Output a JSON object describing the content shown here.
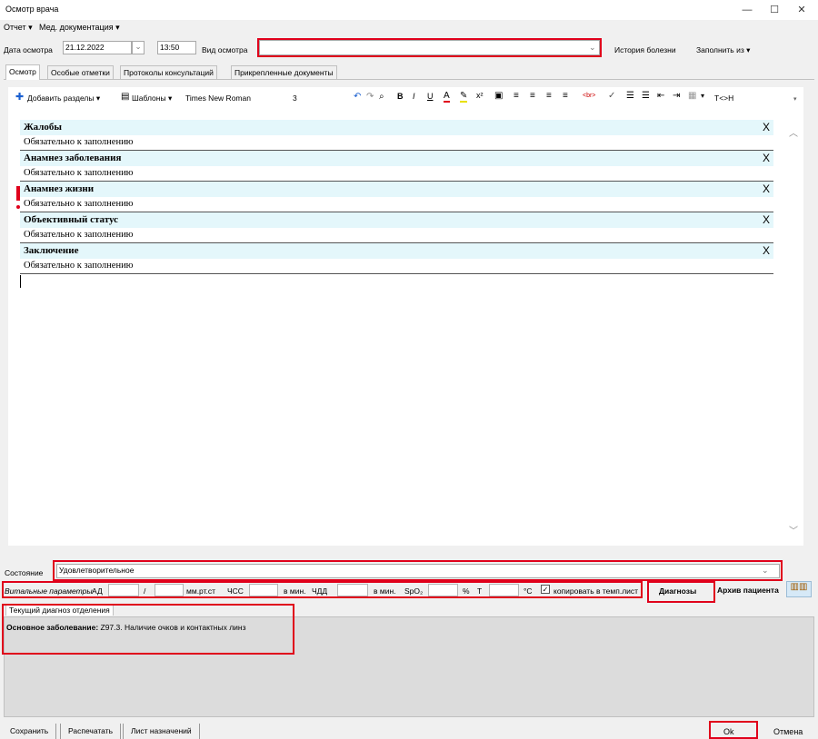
{
  "window": {
    "title": "Осмотр врача"
  },
  "menu": {
    "report": "Отчет ▾",
    "meddocs": "Мед. документация ▾"
  },
  "header": {
    "date_label": "Дата осмотра",
    "date_value": "21.12.2022",
    "time_value": "13:50",
    "type_label": "Вид осмотра",
    "type_value": "",
    "history_btn": "История болезни",
    "fill_from_btn": "Заполнить из ▾"
  },
  "tabs": [
    "Осмотр",
    "Особые отметки",
    "Протоколы консультаций",
    "Прикрепленные документы"
  ],
  "toolbar": {
    "add_sections": "Добавить разделы ▾",
    "templates": "Шаблоны ▾",
    "font": "Times New Roman",
    "font_size": "3",
    "html_tag": "T<>H"
  },
  "sections": [
    {
      "title": "Жалобы",
      "body": "Обязательно к заполнению"
    },
    {
      "title": "Анамнез заболевания",
      "body": "Обязательно к заполнению"
    },
    {
      "title": "Анамнез жизни",
      "body": "Обязательно к заполнению"
    },
    {
      "title": "Объективный статус",
      "body": "Обязательно к заполнению"
    },
    {
      "title": "Заключение",
      "body": "Обязательно к заполнению"
    }
  ],
  "section_close": "X",
  "state": {
    "label": "Состояние",
    "value": "Удовлетворительное"
  },
  "vitals": {
    "label": "Витальные параметры",
    "ad": "АД",
    "slash": "/",
    "mmhg": "мм.рт.ст",
    "chss": "ЧСС",
    "permin1": "в мин.",
    "chdd": "ЧДД",
    "permin2": "в мин.",
    "spo2": "SpO₂",
    "pct": "%",
    "t": "Т",
    "deg": "°С",
    "copy_label": "копировать в темп.лист",
    "diag_btn": "Диагнозы",
    "archive_btn": "Архив пациента"
  },
  "diagnosis": {
    "tab": "Текущий диагноз отделения",
    "main_label": "Основное заболевание:",
    "main_value": " Z97.3. Наличие очков и контактных линз"
  },
  "footer": {
    "save": "Сохранить",
    "print": "Распечатать",
    "prescriptions": "Лист назначений",
    "ok": "Ok",
    "cancel": "Отмена"
  }
}
